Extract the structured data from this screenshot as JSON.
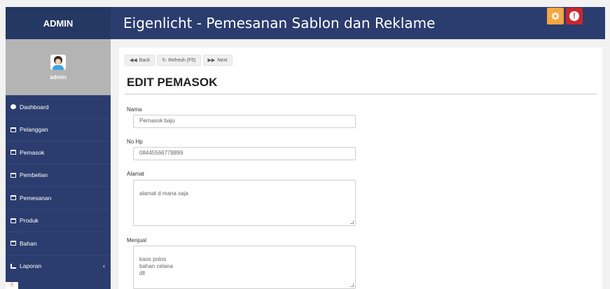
{
  "header": {
    "brand": "ADMIN",
    "title": "Eigenlicht - Pemesanan Sablon dan Reklame",
    "alert_glyph": "!"
  },
  "sidebar": {
    "user_name": "admin",
    "items": [
      {
        "label": "Dashboard",
        "icon": "dashboard-icon"
      },
      {
        "label": "Pelanggan",
        "icon": "table-icon"
      },
      {
        "label": "Pemasok",
        "icon": "table-icon"
      },
      {
        "label": "Pembelian",
        "icon": "table-icon"
      },
      {
        "label": "Pemesanan",
        "icon": "table-icon"
      },
      {
        "label": "Produk",
        "icon": "table-icon"
      },
      {
        "label": "Bahan",
        "icon": "table-icon"
      },
      {
        "label": "Laporan",
        "icon": "chart-icon"
      }
    ],
    "chevron": "‹",
    "logo_text": "ⓔ"
  },
  "toolbar": {
    "back_label": "Back",
    "refresh_label": "Refresh (F5)",
    "next_label": "Next"
  },
  "form": {
    "title": "EDIT PEMASOK",
    "nama_label": "Nama",
    "nama_value": "Pemasok baju",
    "nohp_label": "No Hp",
    "nohp_value": "08445566778899",
    "alamat_label": "Alamat",
    "alamat_value": "alamat d mana saja",
    "menjual_label": "Menjual",
    "menjual_value": "kaos polos\nbahan celana\ndll"
  },
  "colors": {
    "topbar": "#2b3d6e",
    "sidebar": "#2b3d6e",
    "gear_button": "#f4a742",
    "alert_button": "#c9262f"
  }
}
